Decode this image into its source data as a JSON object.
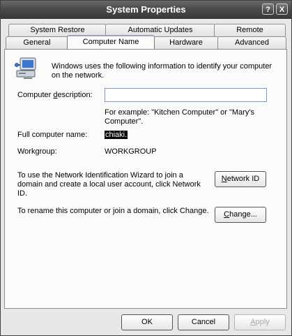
{
  "window": {
    "title": "System Properties",
    "help_glyph": "?",
    "close_glyph": "X"
  },
  "tabs_row1": [
    "System Restore",
    "Automatic Updates",
    "Remote"
  ],
  "tabs_row2": [
    "General",
    "Computer Name",
    "Hardware",
    "Advanced"
  ],
  "active_tab": "Computer Name",
  "computer_name": {
    "intro_line1": "Windows uses the following information to identify your computer",
    "intro_line2": "on the network.",
    "description_label_pre": "Computer ",
    "description_label_key": "d",
    "description_label_post": "escription:",
    "description_value": "",
    "example_line1": "For example: \"Kitchen Computer\" or \"Mary's",
    "example_line2": "Computer\".",
    "full_name_label": "Full computer name:",
    "full_name_value": "chiaki.",
    "workgroup_label": "Workgroup:",
    "workgroup_value": "WORKGROUP",
    "wizard_line1": "To use the Network Identification Wizard to join a",
    "wizard_line2": "domain and create a local user account, click Network",
    "wizard_line3": "ID.",
    "network_id_key": "N",
    "network_id_rest": "etwork ID",
    "rename_text": "To rename this computer or join a domain, click Change.",
    "change_key": "C",
    "change_rest": "hange..."
  },
  "footer": {
    "ok": "OK",
    "cancel": "Cancel",
    "apply_key": "A",
    "apply_rest": "pply"
  },
  "icons": {
    "computer": "computer-network-icon"
  }
}
